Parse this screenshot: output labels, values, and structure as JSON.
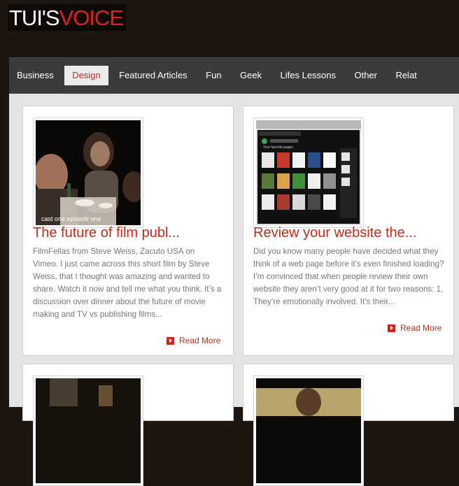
{
  "brand": {
    "part1": "TUI'S",
    "part2": "VOICE"
  },
  "nav": [
    {
      "label": "Business"
    },
    {
      "label": "Design"
    },
    {
      "label": "Featured Articles"
    },
    {
      "label": "Fun"
    },
    {
      "label": "Geek"
    },
    {
      "label": "Lifes Lessons"
    },
    {
      "label": "Other"
    },
    {
      "label": "Relat"
    }
  ],
  "active_nav": "Design",
  "posts": [
    {
      "title": "The future of film publ...",
      "excerpt": "FilmFellas from Steve Weiss, Zacuto USA on Vimeo. I just came across this short film by Steve Weiss, that I thought was amazing and wanted to share. Watch it now and tell me what you think. It’s a discussion over dinner about the future of movie making and TV vs publishing films...",
      "read_more": "Read More",
      "thumb_caption": "cast one  episode one"
    },
    {
      "title": "Review your website the...",
      "excerpt": "Did you know many people have decided what they think of a web page before it’s even finished loading?  I’m convinced that when people review their own website they aren’t very good at it for two reasons: 1, They’re emotionally involved. It’s their...",
      "read_more": "Read More",
      "thumb_caption": "Your favorite pages"
    }
  ]
}
